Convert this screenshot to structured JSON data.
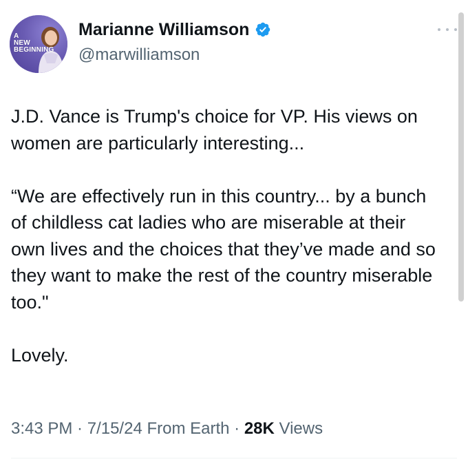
{
  "author": {
    "display_name": "Marianne Williamson",
    "handle": "@marwilliamson",
    "avatar_badge_lines": [
      "A",
      "NEW",
      "BEGINNING"
    ],
    "verified": true
  },
  "tweet": {
    "text": "J.D. Vance is Trump's choice for VP. His views on women are particularly interesting...\n\n“We are effectively run in this country... by a bunch of childless cat ladies who are miserable at their own lives and the choices that they’ve made and so they want to make the rest of the country miserable too.\"\n\nLovely."
  },
  "meta": {
    "time": "3:43 PM",
    "sep1": " · ",
    "date": "7/15/24",
    "source": " From Earth",
    "sep2": " · ",
    "views_count": "28K",
    "views_label": " Views"
  },
  "colors": {
    "verified_blue": "#1d9bf0",
    "secondary_text": "#536471",
    "primary_text": "#0f1419"
  },
  "icons": {
    "verified": "verified-badge-icon",
    "more": "more-options-icon"
  }
}
